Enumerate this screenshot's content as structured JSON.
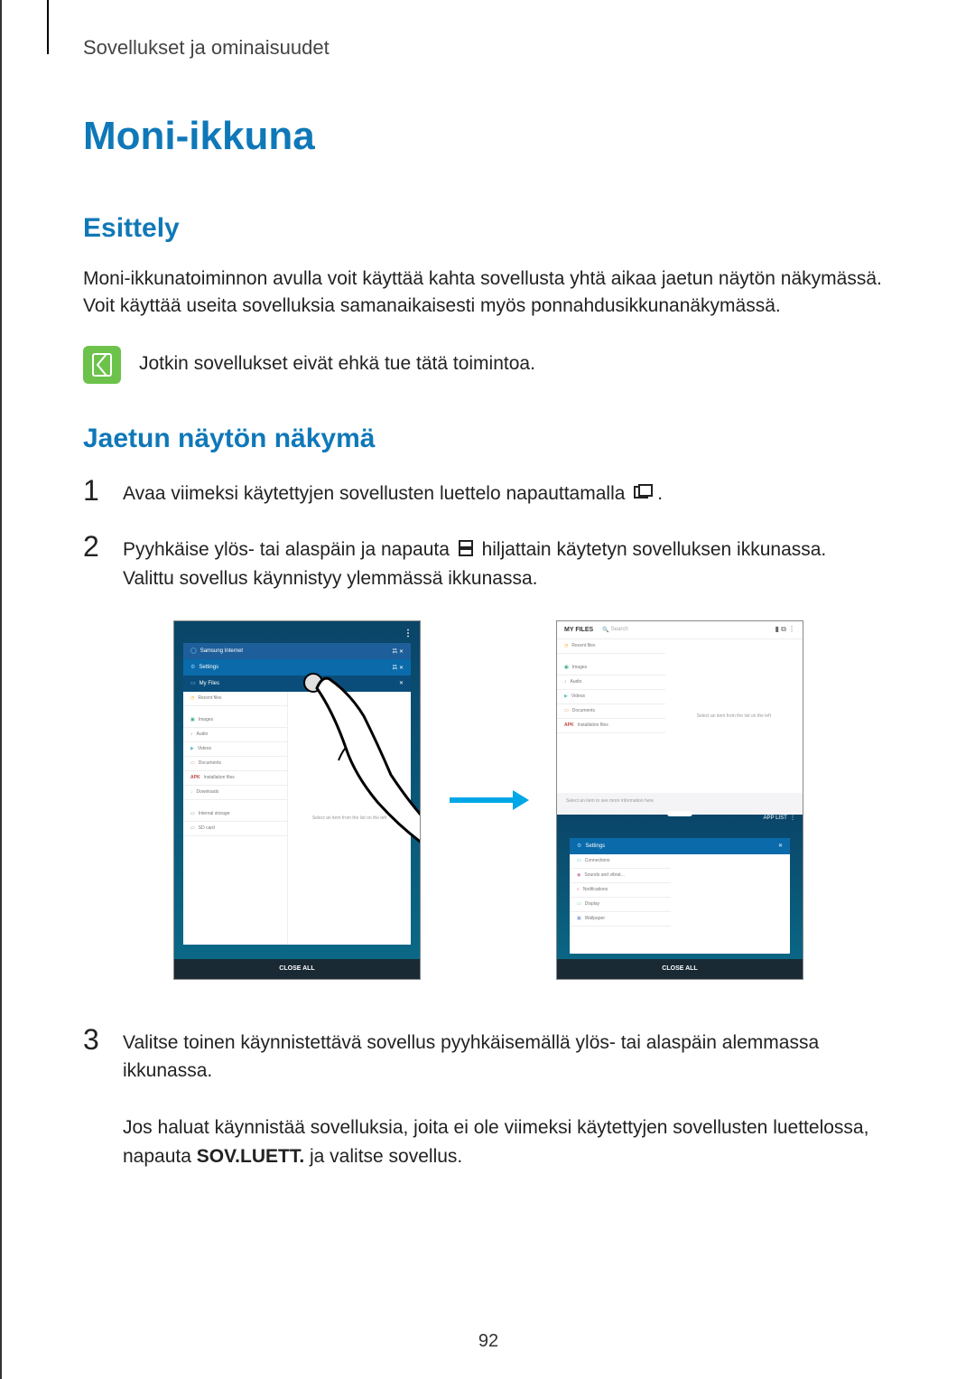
{
  "header": {
    "section": "Sovellukset ja ominaisuudet"
  },
  "title": "Moni-ikkuna",
  "intro": {
    "heading": "Esittely",
    "body": "Moni-ikkunatoiminnon avulla voit käyttää kahta sovellusta yhtä aikaa jaetun näytön näkymässä. Voit käyttää useita sovelluksia samanaikaisesti myös ponnahdusikkunanäkymässä.",
    "note": "Jotkin sovellukset eivät ehkä tue tätä toimintoa."
  },
  "split": {
    "heading": "Jaetun näytön näkymä",
    "steps": [
      {
        "num": "1",
        "before_icon": "Avaa viimeksi käytettyjen sovellusten luettelo napauttamalla ",
        "after_icon": "."
      },
      {
        "num": "2",
        "before_icon": "Pyyhkäise ylös- tai alaspäin ja napauta ",
        "after_icon": " hiljattain käytetyn sovelluksen ikkunassa.",
        "line2": "Valittu sovellus käynnistyy ylemmässä ikkunassa."
      },
      {
        "num": "3",
        "text": "Valitse toinen käynnistettävä sovellus pyyhkäisemällä ylös- tai alaspäin alemmassa ikkunassa.",
        "text2a": "Jos haluat käynnistää sovelluksia, joita ei ole viimeksi käytettyjen sovellusten luettelossa, napauta ",
        "bold": "SOV.LUETT.",
        "text2b": " ja valitse sovellus."
      }
    ]
  },
  "figure": {
    "left": {
      "cards": [
        "Samsung Internet",
        "Settings",
        "My Files"
      ],
      "rows": [
        "Recent files",
        "Images",
        "Audio",
        "Videos",
        "Documents",
        "Installation files",
        "Downloads",
        "Internal storage",
        "SD card"
      ],
      "placeholder": "Select an item from the list on the left",
      "close": "CLOSE ALL"
    },
    "right": {
      "top_title": "MY FILES",
      "search": "Search",
      "rows_top": [
        "Recent files",
        "Images",
        "Audio",
        "Videos",
        "Documents",
        "Installation files"
      ],
      "placeholder_top": "Select an item from the list on the left",
      "hint": "Select an item to see more information here",
      "applist": "APP LIST",
      "bottom_rows": [
        "Connections",
        "Sounds and vibrat...",
        "Notifications",
        "Display",
        "Wallpaper"
      ],
      "close": "CLOSE ALL"
    }
  },
  "page_number": "92"
}
